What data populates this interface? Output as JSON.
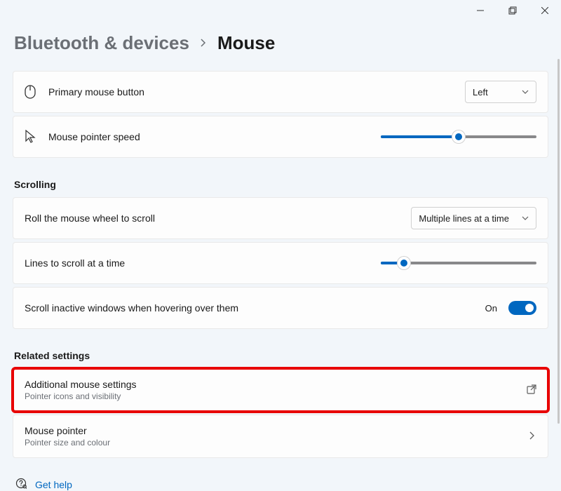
{
  "breadcrumb": {
    "parent": "Bluetooth & devices",
    "current": "Mouse"
  },
  "rows": {
    "primaryButton": {
      "label": "Primary mouse button",
      "value": "Left"
    },
    "pointerSpeed": {
      "label": "Mouse pointer speed",
      "percent": 50
    },
    "scrollWheel": {
      "label": "Roll the mouse wheel to scroll",
      "value": "Multiple lines at a time"
    },
    "linesToScroll": {
      "label": "Lines to scroll at a time",
      "percent": 15
    },
    "inactive": {
      "label": "Scroll inactive windows when hovering over them",
      "stateText": "On",
      "state": true
    }
  },
  "sections": {
    "scrolling": "Scrolling",
    "related": "Related settings"
  },
  "related": {
    "additional": {
      "title": "Additional mouse settings",
      "subtitle": "Pointer icons and visibility"
    },
    "pointer": {
      "title": "Mouse pointer",
      "subtitle": "Pointer size and colour"
    }
  },
  "help": {
    "label": "Get help"
  }
}
